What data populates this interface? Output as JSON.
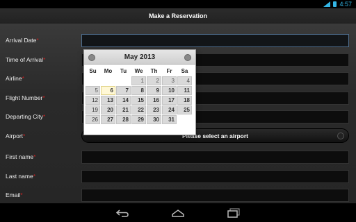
{
  "status_bar": {
    "time": "4:57"
  },
  "title_bar": {
    "title": "Make a Reservation"
  },
  "form": {
    "fields": [
      {
        "label": "Arrival Date",
        "required": "*"
      },
      {
        "label": "Time of Arrival",
        "required": "*"
      },
      {
        "label": "Airline",
        "required": "*"
      },
      {
        "label": "Flight Number",
        "required": "*"
      },
      {
        "label": "Departing City",
        "required": "*"
      },
      {
        "label": "Airport",
        "required": "*"
      },
      {
        "label": "First name",
        "required": "*"
      },
      {
        "label": "Last name",
        "required": "*"
      },
      {
        "label": "Email",
        "required": "*"
      }
    ],
    "airport_button": "Please select an airport"
  },
  "calendar": {
    "month_title": "May 2013",
    "weekdays": [
      "Su",
      "Mo",
      "Tu",
      "We",
      "Th",
      "Fr",
      "Sa"
    ],
    "weeks": [
      [
        "",
        "",
        "",
        "1",
        "2",
        "3",
        "4"
      ],
      [
        "5",
        "6",
        "7",
        "8",
        "9",
        "10",
        "11"
      ],
      [
        "12",
        "13",
        "14",
        "15",
        "16",
        "17",
        "18"
      ],
      [
        "19",
        "20",
        "21",
        "22",
        "23",
        "24",
        "25"
      ],
      [
        "26",
        "27",
        "28",
        "29",
        "30",
        "31",
        ""
      ]
    ],
    "today": "6"
  },
  "colors": {
    "accent": "#33b5e5",
    "required": "#cc2222"
  }
}
